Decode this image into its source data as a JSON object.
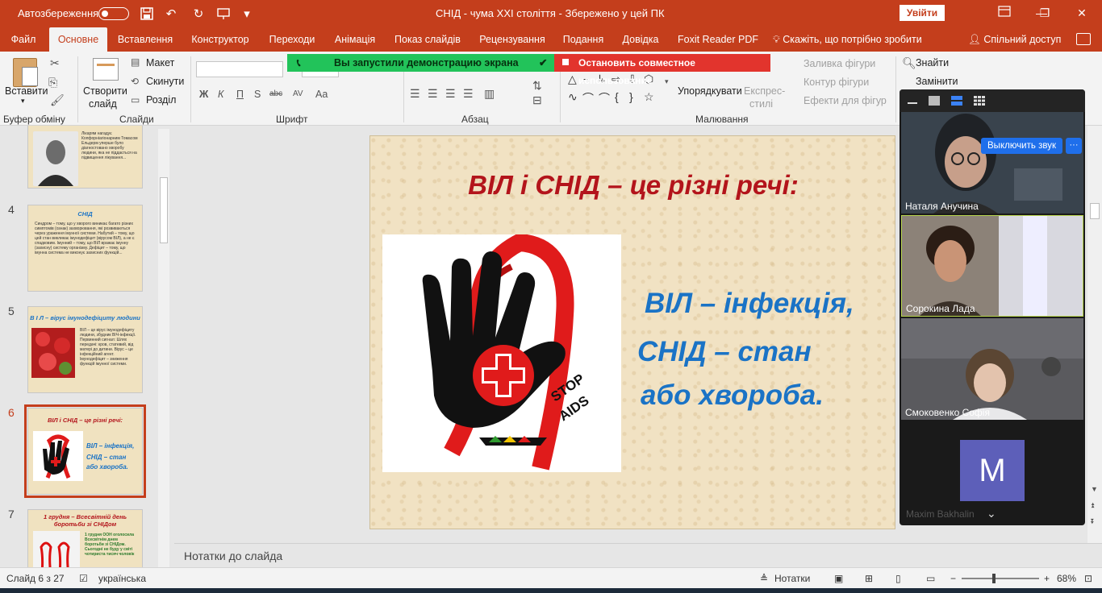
{
  "titlebar": {
    "autosave_label": "Автозбереження",
    "doc_title": "СНІД - чума ХХІ століття  -  Збережено у цей ПК",
    "signin_label": "Увійти",
    "minimize": "—",
    "restore": "❐",
    "close": "✕"
  },
  "tabs": [
    "Файл",
    "Основне",
    "Вставлення",
    "Конструктор",
    "Переходи",
    "Анімація",
    "Показ слайдів",
    "Рецензування",
    "Подання",
    "Довідка",
    "Foxit Reader PDF"
  ],
  "active_tab": "Основне",
  "tell_me": "Скажіть, що потрібно зробити",
  "share_label": "Спільний доступ",
  "ribbon": {
    "paste": "Вставити",
    "clipboard_group": "Буфер обміну",
    "new_slide_1": "Створити",
    "new_slide_2": "слайд",
    "layout": "Макет",
    "reset": "Скинути",
    "section": "Розділ",
    "slides_group": "Слайди",
    "font_group": "Шрифт",
    "paragraph_group": "Абзац",
    "arrange": "Упорядкувати",
    "quick_styles_1": "Експрес-",
    "quick_styles_2": "стилі",
    "shape_fill": "Заливка фігури",
    "shape_outline": "Контур фігури",
    "shape_effects": "Ефекти для фігур",
    "drawing_group": "Малювання",
    "find": "Знайти",
    "replace": "Замінити",
    "font_buttons": [
      "Ж",
      "К",
      "П",
      "S",
      "abc",
      "AV",
      "Aa"
    ]
  },
  "screen_share": {
    "started": "Вы запустили демонстрацию экрана",
    "stop": "Остановить совместное использование"
  },
  "thumbnails": [
    {
      "num": "",
      "title": "",
      "text": "Лікарям нагадує Копфорніагіонарним Томасом Ельдерм уперше було діагностовано хворобу людини, яка не піддається на підвищення лікування..."
    },
    {
      "num": "4",
      "title": "СНІД",
      "text": "Синдром – тому, що у хворого виникає багато різних симптомів (ознак) захворювання, які розвиваються через ураження імунної системи. Набутий – тому, що цей стан викликає імунодефіцит (вірусом ВІЛ), а не є спадковим. Імунний – тому, що ВІЛ вражає імунну (захисну) систему організму. Дефіцит – тому, що імунна система не виконує захисних функцій..."
    },
    {
      "num": "5",
      "title": "В І Л – вірус імунодефіциту людини",
      "text": "ВІЛ – це вірус імунодефіциту людини, збудник ВІЧ-інфекції. Первинний сигнал: Шлях передачі: кров, статевий, від матері до дитини. Вірус – це інфекційний агент. Імунодефіцит – зниження функцій імунної системи."
    },
    {
      "num": "6",
      "title": "ВІЛ і СНІД – це різні речі:",
      "text": ""
    },
    {
      "num": "7",
      "title": "1 грудня – Всесвітній день боротьби зі СНІДом",
      "text": "1 грудня ООН оголосила Всесвітнім днем боротьби зі СНІДом. Сьогодні не буду у світі чотириста тисяч чоловік"
    }
  ],
  "slide": {
    "title": "ВІЛ і СНІД – це різні речі:",
    "line1": "ВІЛ – інфекція,",
    "line2": "СНІД – стан",
    "line3": "або хвороба.",
    "image_text_1": "STOP",
    "image_text_2": "AIDS"
  },
  "thumb6_lines": [
    "ВІЛ – інфекція,",
    "СНІД – стан",
    "або хвороба."
  ],
  "notes_label": "Нотатки до слайда",
  "status": {
    "slide_counter": "Слайд 6 з 27",
    "language": "українська",
    "notes": "Нотатки",
    "zoom": "68%",
    "zoom_fraction": 0.42
  },
  "video_panel": {
    "unmute": "Выключить звук",
    "more": "···",
    "participants": [
      {
        "name": "Наталя Анучина"
      },
      {
        "name": "Сорокина Лада"
      },
      {
        "name": "Смоковенко Софія"
      }
    ],
    "avatar_letter": "M",
    "last_name": "Maxim Bakhalin"
  },
  "colors": {
    "ppt_accent": "#c43e1c",
    "slide_title": "#b3141b",
    "slide_body": "#1a73c6",
    "share_green": "#22c35a",
    "share_red": "#e2342d",
    "zoom_blue": "#1f6feb"
  }
}
